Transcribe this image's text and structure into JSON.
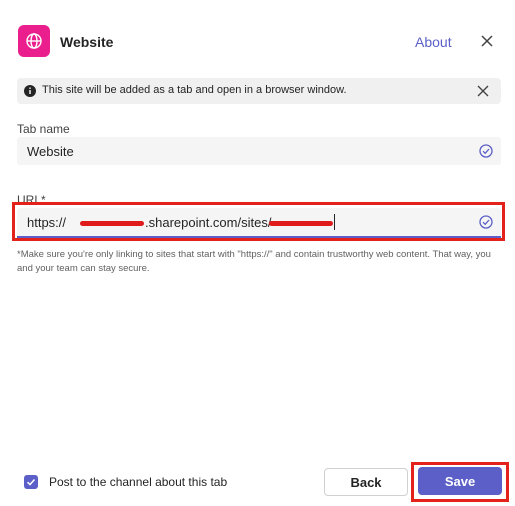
{
  "header": {
    "title": "Website",
    "about_label": "About",
    "app_icon": "globe-icon",
    "brand_color": "#ea1e8c"
  },
  "banner": {
    "text": "This site will be added as a tab and open in a browser window.",
    "icon": "info-icon"
  },
  "tab_name": {
    "label": "Tab name",
    "value": "Website"
  },
  "url": {
    "label": "URL*",
    "value_prefix": "https://",
    "value_middle": ".sharepoint.com/sites/"
  },
  "note": "*Make sure you're only linking to sites that start with \"https://\" and contain trustworthy web content. That way, you and your team can stay secure.",
  "footer": {
    "post_label": "Post to the channel about this tab",
    "post_checked": true,
    "back_label": "Back",
    "save_label": "Save"
  },
  "colors": {
    "accent": "#5b5fc7",
    "highlight": "#e3221c"
  }
}
